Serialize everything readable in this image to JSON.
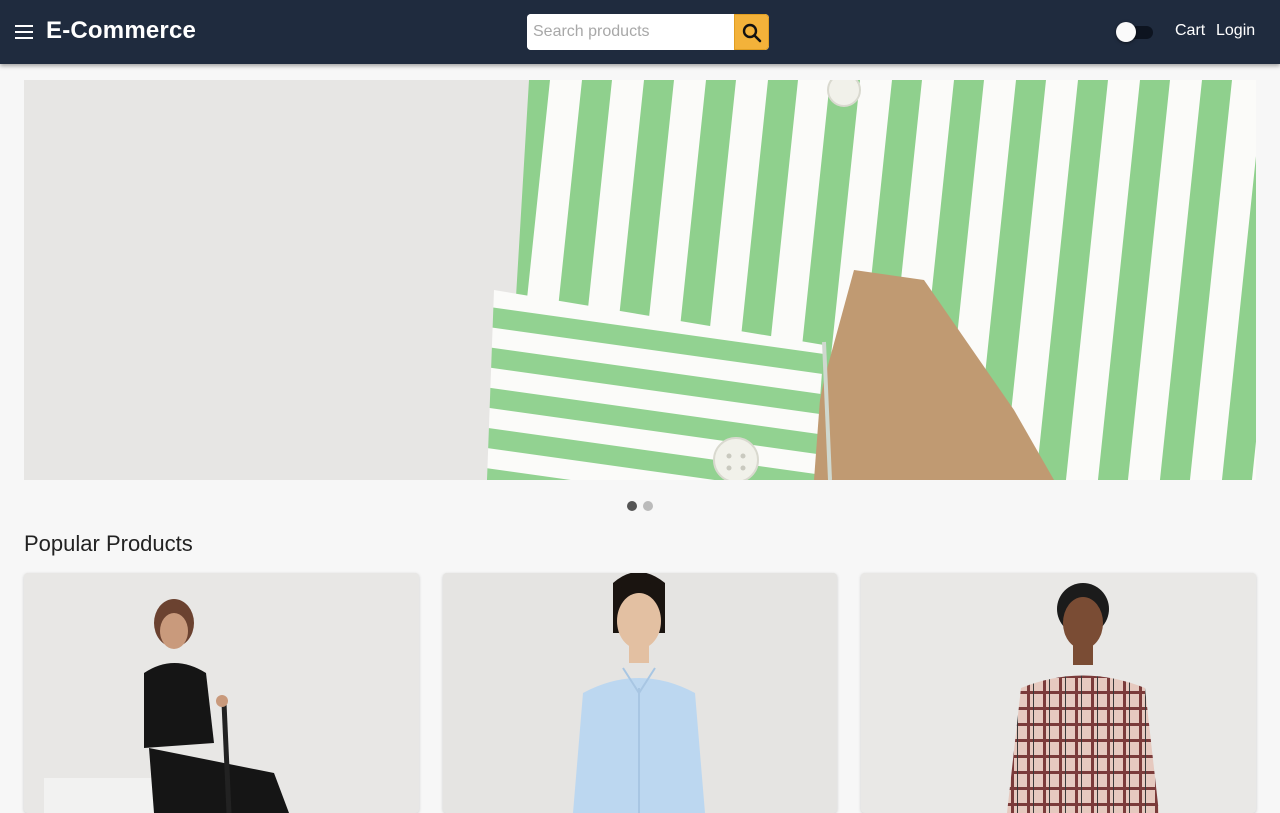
{
  "header": {
    "brand": "E-Commerce",
    "search_placeholder": "Search products",
    "search_value": "",
    "cart_label": "Cart",
    "login_label": "Login",
    "theme_toggle_on": false
  },
  "carousel": {
    "slide_count": 2,
    "active_index": 0
  },
  "popular": {
    "title": "Popular Products",
    "products": [
      {
        "image": "black polo shirt model"
      },
      {
        "image": "light blue oxford shirt model"
      },
      {
        "image": "checked shirt model"
      }
    ]
  },
  "colors": {
    "appbar": "#1f2b3e",
    "search_button": "#f3b23a",
    "page_bg": "#f7f7f7",
    "dot_active": "#555555",
    "dot_inactive": "#bbbbbb"
  },
  "icons": [
    "menu-icon",
    "search-icon"
  ]
}
